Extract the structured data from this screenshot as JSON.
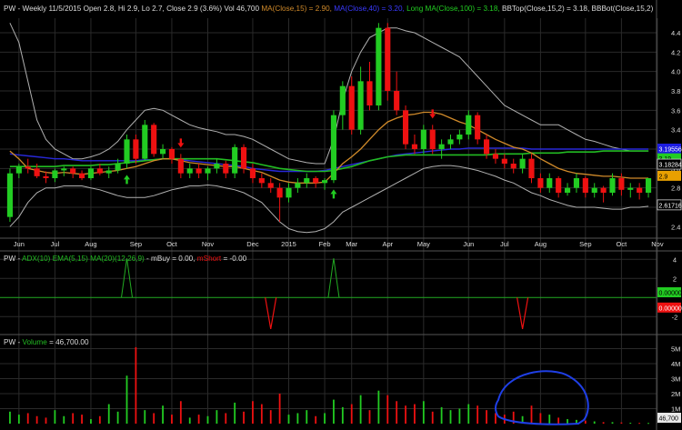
{
  "chart_data": [
    {
      "panel": "price",
      "type": "candlestick",
      "header": {
        "symbol": "PW",
        "period": "Weekly",
        "date": "11/5/2015",
        "ohlc_text": "Open 2.8, Hi 2.9, Lo 2.7, Close 2.9 (3.6%)",
        "vol_text": "Vol 46,700",
        "ma_text": "MA(Close,15) = 2.90,",
        "ma_blue_text": "MA(Close,40) = 3.20,",
        "long_ma_text": "Long MA(Close,100) = 3.18,",
        "bbtop_text": "BBTop(Close,15,2) = 3.18,",
        "bbbot_text": "BBBot(Close,15,2)"
      },
      "ylim": [
        2.3,
        4.55
      ],
      "y_ticks": [
        2.4,
        2.6,
        2.8,
        3.0,
        3.2,
        3.4,
        3.6,
        3.8,
        4.0,
        4.2,
        4.4
      ],
      "x_labels": [
        {
          "label": "Jun",
          "week": 1
        },
        {
          "label": "Jul",
          "week": 5
        },
        {
          "label": "Aug",
          "week": 9
        },
        {
          "label": "Sep",
          "week": 14
        },
        {
          "label": "Oct",
          "week": 18
        },
        {
          "label": "Nov",
          "week": 22
        },
        {
          "label": "Dec",
          "week": 27
        },
        {
          "label": "2015",
          "week": 31
        },
        {
          "label": "Feb",
          "week": 35
        },
        {
          "label": "Mar",
          "week": 38
        },
        {
          "label": "Apr",
          "week": 42
        },
        {
          "label": "May",
          "week": 46
        },
        {
          "label": "Jun",
          "week": 51
        },
        {
          "label": "Jul",
          "week": 55
        },
        {
          "label": "Aug",
          "week": 59
        },
        {
          "label": "Sep",
          "week": 64
        },
        {
          "label": "Oct",
          "week": 68
        },
        {
          "label": "Nov",
          "week": 72
        }
      ],
      "candles": [
        [
          2.5,
          3.0,
          2.45,
          2.95
        ],
        [
          2.95,
          3.05,
          2.9,
          3.02
        ],
        [
          3.02,
          3.1,
          2.95,
          3.0
        ],
        [
          3.0,
          3.05,
          2.9,
          2.92
        ],
        [
          2.92,
          2.97,
          2.85,
          2.9
        ],
        [
          2.9,
          3.0,
          2.86,
          2.98
        ],
        [
          2.98,
          3.02,
          2.92,
          3.0
        ],
        [
          3.0,
          3.02,
          2.9,
          2.95
        ],
        [
          2.95,
          2.98,
          2.88,
          2.9
        ],
        [
          2.9,
          3.02,
          2.88,
          3.0
        ],
        [
          3.0,
          3.05,
          2.93,
          2.95
        ],
        [
          2.95,
          3.02,
          2.9,
          2.98
        ],
        [
          2.98,
          3.1,
          2.95,
          3.05
        ],
        [
          3.05,
          3.35,
          3.0,
          3.3
        ],
        [
          3.3,
          3.35,
          3.05,
          3.1
        ],
        [
          3.1,
          3.5,
          3.08,
          3.45
        ],
        [
          3.45,
          3.47,
          3.12,
          3.15
        ],
        [
          3.15,
          3.25,
          3.1,
          3.2
        ],
        [
          3.2,
          3.22,
          3.05,
          3.1
        ],
        [
          3.1,
          3.15,
          2.9,
          2.95
        ],
        [
          2.95,
          3.05,
          2.9,
          3.0
        ],
        [
          3.0,
          3.05,
          2.9,
          2.95
        ],
        [
          2.95,
          3.02,
          2.88,
          3.0
        ],
        [
          3.0,
          3.1,
          2.95,
          3.05
        ],
        [
          3.05,
          3.08,
          2.9,
          2.95
        ],
        [
          2.95,
          3.25,
          2.9,
          3.22
        ],
        [
          3.22,
          3.25,
          2.95,
          3.0
        ],
        [
          3.0,
          3.05,
          2.85,
          2.9
        ],
        [
          2.9,
          2.95,
          2.8,
          2.85
        ],
        [
          2.85,
          2.9,
          2.75,
          2.8
        ],
        [
          2.8,
          2.85,
          2.45,
          2.7
        ],
        [
          2.7,
          2.85,
          2.65,
          2.8
        ],
        [
          2.8,
          2.9,
          2.75,
          2.85
        ],
        [
          2.85,
          2.95,
          2.8,
          2.9
        ],
        [
          2.9,
          2.92,
          2.8,
          2.85
        ],
        [
          2.85,
          2.9,
          2.78,
          2.88
        ],
        [
          2.88,
          3.6,
          2.85,
          3.55
        ],
        [
          3.55,
          3.9,
          3.4,
          3.85
        ],
        [
          3.85,
          3.95,
          3.35,
          3.4
        ],
        [
          3.4,
          4.05,
          3.35,
          3.9
        ],
        [
          3.9,
          4.1,
          3.6,
          3.65
        ],
        [
          3.65,
          4.5,
          3.6,
          4.45
        ],
        [
          4.45,
          4.5,
          3.7,
          3.8
        ],
        [
          3.8,
          4.0,
          3.55,
          3.6
        ],
        [
          3.6,
          3.65,
          3.2,
          3.25
        ],
        [
          3.25,
          3.35,
          3.15,
          3.2
        ],
        [
          3.2,
          3.45,
          3.15,
          3.4
        ],
        [
          3.4,
          3.45,
          3.15,
          3.2
        ],
        [
          3.2,
          3.3,
          3.1,
          3.25
        ],
        [
          3.25,
          3.35,
          3.2,
          3.3
        ],
        [
          3.3,
          3.4,
          3.25,
          3.35
        ],
        [
          3.35,
          3.6,
          3.3,
          3.55
        ],
        [
          3.55,
          3.58,
          3.25,
          3.3
        ],
        [
          3.3,
          3.35,
          3.1,
          3.15
        ],
        [
          3.15,
          3.2,
          3.05,
          3.1
        ],
        [
          3.1,
          3.15,
          3.0,
          3.05
        ],
        [
          3.05,
          3.1,
          2.95,
          3.0
        ],
        [
          3.0,
          3.15,
          2.95,
          3.1
        ],
        [
          3.1,
          3.15,
          2.85,
          2.9
        ],
        [
          2.9,
          2.95,
          2.75,
          2.8
        ],
        [
          2.8,
          2.95,
          2.75,
          2.9
        ],
        [
          2.9,
          2.92,
          2.7,
          2.75
        ],
        [
          2.75,
          2.85,
          2.72,
          2.8
        ],
        [
          2.8,
          2.95,
          2.75,
          2.9
        ],
        [
          2.9,
          2.92,
          2.7,
          2.75
        ],
        [
          2.75,
          2.85,
          2.7,
          2.8
        ],
        [
          2.8,
          2.82,
          2.65,
          2.75
        ],
        [
          2.75,
          2.95,
          2.72,
          2.9
        ],
        [
          2.9,
          2.95,
          2.72,
          2.78
        ],
        [
          2.78,
          2.85,
          2.7,
          2.8
        ],
        [
          2.8,
          2.85,
          2.68,
          2.75
        ],
        [
          2.75,
          2.9,
          2.7,
          2.9
        ]
      ],
      "ma15": [
        3.18,
        3.1,
        3.0,
        2.98,
        2.96,
        2.95,
        2.96,
        2.95,
        2.94,
        2.95,
        2.96,
        2.97,
        2.98,
        3.0,
        3.02,
        3.05,
        3.08,
        3.1,
        3.1,
        3.08,
        3.06,
        3.05,
        3.04,
        3.03,
        3.02,
        3.02,
        3.0,
        2.98,
        2.96,
        2.92,
        2.88,
        2.86,
        2.85,
        2.85,
        2.85,
        2.86,
        2.95,
        3.05,
        3.12,
        3.2,
        3.3,
        3.4,
        3.48,
        3.52,
        3.55,
        3.56,
        3.58,
        3.58,
        3.56,
        3.52,
        3.48,
        3.45,
        3.4,
        3.35,
        3.3,
        3.26,
        3.22,
        3.2,
        3.16,
        3.1,
        3.05,
        3.0,
        2.97,
        2.95,
        2.94,
        2.93,
        2.92,
        2.92,
        2.91,
        2.9,
        2.9,
        2.9
      ],
      "ma40": [
        3.15,
        3.14,
        3.13,
        3.12,
        3.11,
        3.1,
        3.1,
        3.09,
        3.08,
        3.08,
        3.08,
        3.08,
        3.08,
        3.08,
        3.08,
        3.09,
        3.09,
        3.1,
        3.1,
        3.09,
        3.08,
        3.07,
        3.06,
        3.05,
        3.04,
        3.03,
        3.02,
        3.0,
        2.99,
        2.98,
        2.97,
        2.97,
        2.97,
        2.97,
        2.97,
        2.98,
        3.0,
        3.02,
        3.04,
        3.06,
        3.08,
        3.1,
        3.12,
        3.14,
        3.15,
        3.16,
        3.17,
        3.18,
        3.19,
        3.2,
        3.2,
        3.21,
        3.21,
        3.21,
        3.21,
        3.21,
        3.21,
        3.21,
        3.2,
        3.2,
        3.2,
        3.2,
        3.2,
        3.2,
        3.2,
        3.2,
        3.2,
        3.2,
        3.2,
        3.2,
        3.2,
        3.2
      ],
      "ma100": [
        3.02,
        3.02,
        3.02,
        3.02,
        3.02,
        3.02,
        3.03,
        3.03,
        3.03,
        3.03,
        3.04,
        3.04,
        3.05,
        3.06,
        3.07,
        3.08,
        3.09,
        3.1,
        3.1,
        3.1,
        3.1,
        3.1,
        3.1,
        3.1,
        3.09,
        3.08,
        3.07,
        3.06,
        3.04,
        3.02,
        3.0,
        2.99,
        2.98,
        2.97,
        2.97,
        2.97,
        2.98,
        3.0,
        3.02,
        3.05,
        3.08,
        3.1,
        3.12,
        3.13,
        3.14,
        3.14,
        3.14,
        3.14,
        3.14,
        3.14,
        3.14,
        3.14,
        3.14,
        3.14,
        3.15,
        3.15,
        3.15,
        3.15,
        3.16,
        3.16,
        3.16,
        3.16,
        3.17,
        3.17,
        3.17,
        3.17,
        3.18,
        3.18,
        3.18,
        3.18,
        3.18,
        3.18
      ],
      "bb_top": [
        4.5,
        4.3,
        3.9,
        3.5,
        3.3,
        3.2,
        3.15,
        3.1,
        3.1,
        3.12,
        3.15,
        3.2,
        3.28,
        3.4,
        3.5,
        3.6,
        3.62,
        3.6,
        3.55,
        3.5,
        3.45,
        3.42,
        3.4,
        3.38,
        3.35,
        3.35,
        3.33,
        3.3,
        3.25,
        3.2,
        3.15,
        3.1,
        3.08,
        3.06,
        3.05,
        3.05,
        3.3,
        3.7,
        4.0,
        4.2,
        4.35,
        4.4,
        4.45,
        4.45,
        4.42,
        4.4,
        4.35,
        4.3,
        4.25,
        4.2,
        4.15,
        4.05,
        3.95,
        3.85,
        3.75,
        3.65,
        3.6,
        3.55,
        3.5,
        3.45,
        3.45,
        3.45,
        3.4,
        3.35,
        3.3,
        3.28,
        3.25,
        3.22,
        3.2,
        3.18,
        3.18,
        3.18
      ],
      "bb_bot": [
        2.4,
        2.5,
        2.65,
        2.75,
        2.8,
        2.8,
        2.82,
        2.82,
        2.82,
        2.8,
        2.78,
        2.75,
        2.72,
        2.7,
        2.7,
        2.7,
        2.72,
        2.75,
        2.78,
        2.8,
        2.82,
        2.82,
        2.83,
        2.82,
        2.8,
        2.78,
        2.75,
        2.7,
        2.65,
        2.55,
        2.45,
        2.38,
        2.35,
        2.34,
        2.35,
        2.38,
        2.45,
        2.55,
        2.6,
        2.65,
        2.7,
        2.75,
        2.8,
        2.85,
        2.9,
        2.95,
        3.0,
        3.02,
        3.03,
        3.03,
        3.02,
        3.0,
        2.98,
        2.95,
        2.92,
        2.88,
        2.85,
        2.8,
        2.75,
        2.72,
        2.68,
        2.65,
        2.62,
        2.6,
        2.6,
        2.6,
        2.59,
        2.58,
        2.58,
        2.6,
        2.6,
        2.61
      ],
      "buy_arrows": [
        13,
        36
      ],
      "sell_arrows": [
        19,
        47
      ],
      "axis_tags": [
        {
          "label": "3.19556",
          "value": 3.2,
          "bg": "#1c1ce0",
          "fg": "#ffffff"
        },
        {
          "label": "3.19",
          "value": 3.1,
          "bg": "#22cc22",
          "fg": "#000000"
        },
        {
          "label": "3.18284",
          "value": 3.04,
          "bg": "#000000",
          "fg": "#ffffff",
          "border": "#cccccc"
        },
        {
          "label": "2.9",
          "value": 2.92,
          "bg": "#e8a000",
          "fg": "#000000"
        },
        {
          "label": "2.61716",
          "value": 2.62,
          "bg": "#000000",
          "fg": "#ffffff",
          "border": "#cccccc"
        }
      ]
    },
    {
      "panel": "indicator",
      "type": "line",
      "header": {
        "prefix": "PW - ",
        "adx_text": "ADX(10)",
        "ema_text": "EMA(5,15)",
        "ma_text": "MA(20)(12,26,9)",
        "mbuy_text": "- mBuy = 0.00,",
        "mshort_text": "mShort",
        "mshort_value": "= -0.00"
      },
      "ylim": [
        -3.5,
        4.5
      ],
      "y_ticks": [
        4,
        2,
        -2
      ],
      "zero_line": 0,
      "buy_spikes": [
        13,
        36
      ],
      "short_spikes": [
        29,
        57
      ],
      "axis_tags": [
        {
          "label": "0.00000",
          "value": 0.5,
          "bg": "#22cc22",
          "fg": "#000000"
        },
        {
          "label": "0.00000",
          "value": -1.1,
          "bg": "#ee1111",
          "fg": "#ffffff"
        }
      ]
    },
    {
      "panel": "volume",
      "type": "bar",
      "header": {
        "prefix": "PW - ",
        "label": "Volume",
        "value_text": "= 46,700.00"
      },
      "ylim": [
        0,
        5700000
      ],
      "y_ticks": [
        {
          "label": "5M",
          "value": 5000000
        },
        {
          "label": "4M",
          "value": 4000000
        },
        {
          "label": "3M",
          "value": 3000000
        },
        {
          "label": "2M",
          "value": 2000000
        },
        {
          "label": "1M",
          "value": 1000000
        }
      ],
      "values": [
        800000,
        600000,
        700000,
        500000,
        400000,
        900000,
        500000,
        700000,
        600000,
        300000,
        500000,
        1300000,
        800000,
        3200000,
        5100000,
        900000,
        700000,
        1200000,
        600000,
        1500000,
        400000,
        600000,
        500000,
        900000,
        700000,
        1400000,
        800000,
        1500000,
        1300000,
        900000,
        2000000,
        600000,
        700000,
        900000,
        500000,
        700000,
        1600000,
        1100000,
        1300000,
        1900000,
        900000,
        2200000,
        1900000,
        1500000,
        1200000,
        1300000,
        1500000,
        800000,
        1100000,
        900000,
        1000000,
        1300000,
        1200000,
        900000,
        700000,
        600000,
        800000,
        500000,
        1200000,
        700000,
        600000,
        400000,
        300000,
        250000,
        200000,
        150000,
        100000,
        100000,
        80000,
        60000,
        50000,
        46700
      ],
      "value_tag": {
        "label": "46,700",
        "bg": "#e6e6e6",
        "fg": "#000000"
      },
      "annotation": "circle-annotation"
    }
  ],
  "colors": {
    "background": "#000000",
    "grid": "#2a2a2a",
    "up": "#22cc22",
    "down": "#ee1111",
    "ma15": "#d08a2a",
    "ma40": "#2828d8",
    "ma100": "#22bb22",
    "bollinger": "#b0b0b0",
    "label": "#dddddd",
    "annotation": "#1f3fe6"
  }
}
